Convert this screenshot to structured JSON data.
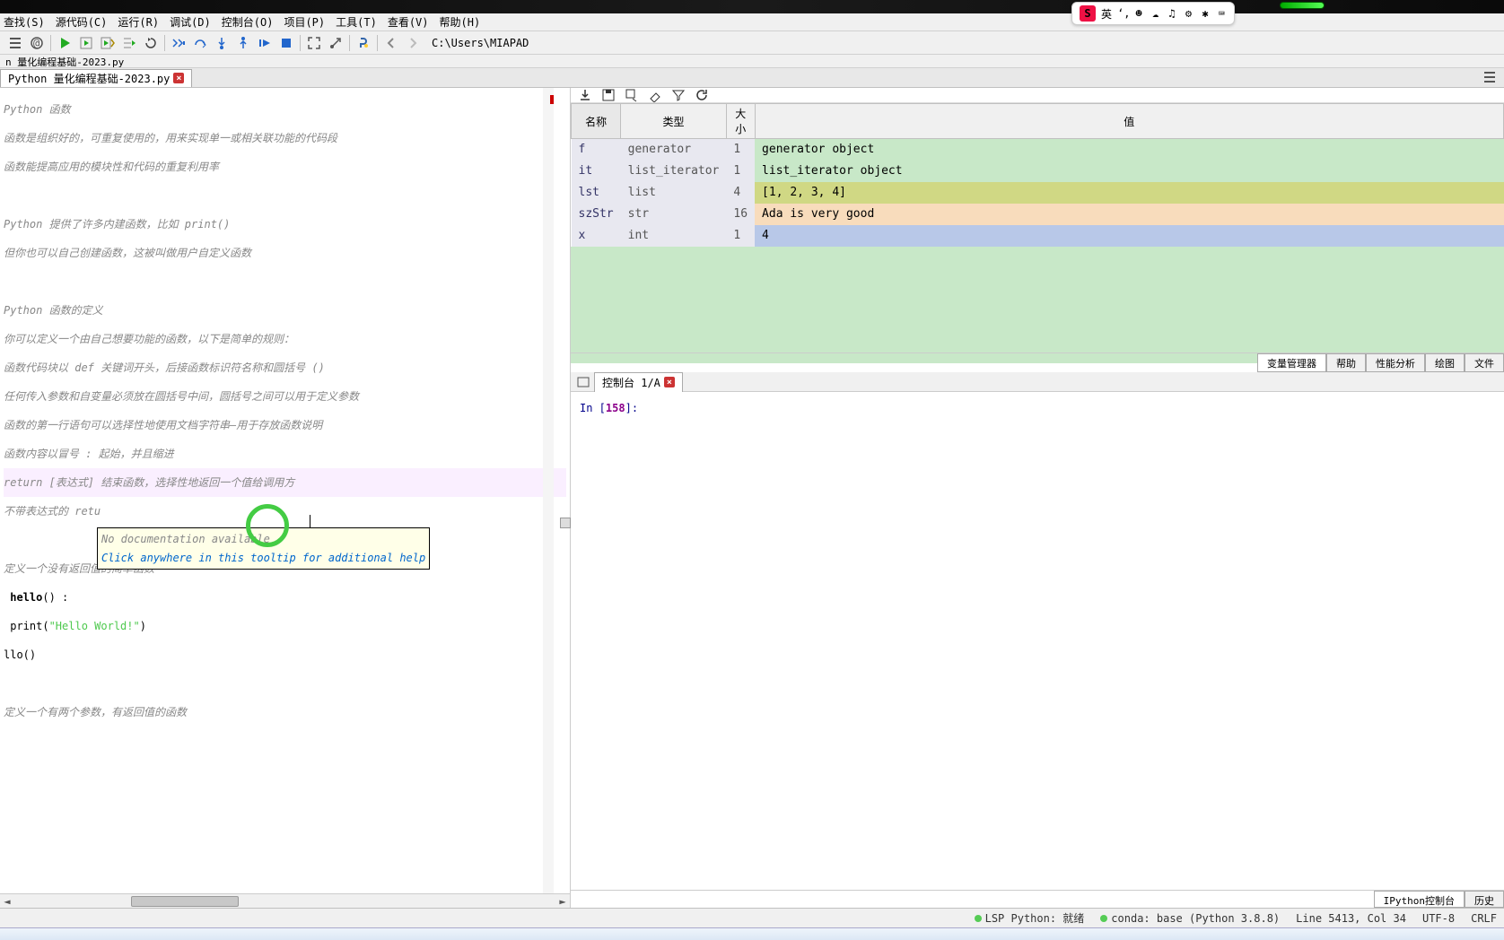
{
  "menubar": {
    "items": [
      "查找(S)",
      "源代码(C)",
      "运行(R)",
      "调试(D)",
      "控制台(O)",
      "项目(P)",
      "工具(T)",
      "查看(V)",
      "帮助(H)"
    ]
  },
  "toolbar": {
    "path": "C:\\Users\\MIAPAD"
  },
  "breadcrumb": "n 量化编程基础-2023.py",
  "editor_tab": {
    "label": "Python 量化编程基础-2023.py"
  },
  "ime": {
    "letter": "S",
    "lang": "英",
    "punct": "‘,",
    "icons": "☻ ☁ ♫ ⚙ ✱ ⌨"
  },
  "editor": {
    "lines": [
      "",
      "Python 函数",
      "",
      "函数是组织好的，可重复使用的，用来实现单一或相关联功能的代码段",
      "",
      "函数能提高应用的模块性和代码的重复利用率",
      "",
      "",
      "Python 提供了许多内建函数，比如 print()",
      "",
      "但你也可以自己创建函数，这被叫做用户自定义函数",
      "",
      "",
      "Python 函数的定义",
      "",
      "你可以定义一个由自己想要功能的函数，以下是简单的规则：",
      "",
      "函数代码块以 def 关键词开头，后接函数标识符名称和圆括号 ()",
      "",
      "任何传入参数和自变量必须放在圆括号中间，圆括号之间可以用于定义参数",
      "",
      "函数的第一行语句可以选择性地使用文档字符串—用于存放函数说明",
      "",
      "函数内容以冒号 : 起始，并且缩进",
      "",
      "return [表达式] 结束函数，选择性地返回一个值给调用方",
      "",
      "不带表达式的 retu",
      "",
      "",
      "定义一个没有返回值的简单函数"
    ],
    "def_line": {
      "kw": "",
      "name": "hello",
      "after": "() :"
    },
    "print_line": {
      "str": "\"Hello World!\""
    },
    "call_line": "llo()",
    "flow_line": "定义一个有两个参数，有返回值的函数"
  },
  "tooltip": {
    "line1": "No documentation available",
    "line2": "Click anywhere in this tooltip for additional help"
  },
  "var_toolbar_icons": [
    "download-icon",
    "save-icon",
    "copy-icon",
    "erase-icon",
    "filter-icon",
    "refresh-icon"
  ],
  "var_table": {
    "headers": {
      "name": "名称",
      "type": "类型",
      "size": "大小",
      "value": "值"
    },
    "rows": [
      {
        "name": "f",
        "type": "generator",
        "size": "1",
        "value": "generator object"
      },
      {
        "name": "it",
        "type": "list_iterator",
        "size": "1",
        "value": "list_iterator object"
      },
      {
        "name": "lst",
        "type": "list",
        "size": "4",
        "value": "[1, 2, 3, 4]"
      },
      {
        "name": "szStr",
        "type": "str",
        "size": "16",
        "value": "Ada is very good"
      },
      {
        "name": "x",
        "type": "int",
        "size": "1",
        "value": "4"
      }
    ]
  },
  "panel_tabs": [
    "变量管理器",
    "帮助",
    "性能分析",
    "绘图",
    "文件"
  ],
  "console": {
    "tab_label": "控制台 1/A",
    "prompt_prefix": "In [",
    "prompt_num": "158",
    "prompt_suffix": "]:"
  },
  "console_bottom_tabs": [
    "IPython控制台",
    "历史"
  ],
  "statusbar": {
    "lsp": "LSP Python: 就绪",
    "conda": "conda: base (Python 3.8.8)",
    "pos": "Line 5413, Col 34",
    "enc": "UTF-8",
    "eol": "CRLF"
  }
}
